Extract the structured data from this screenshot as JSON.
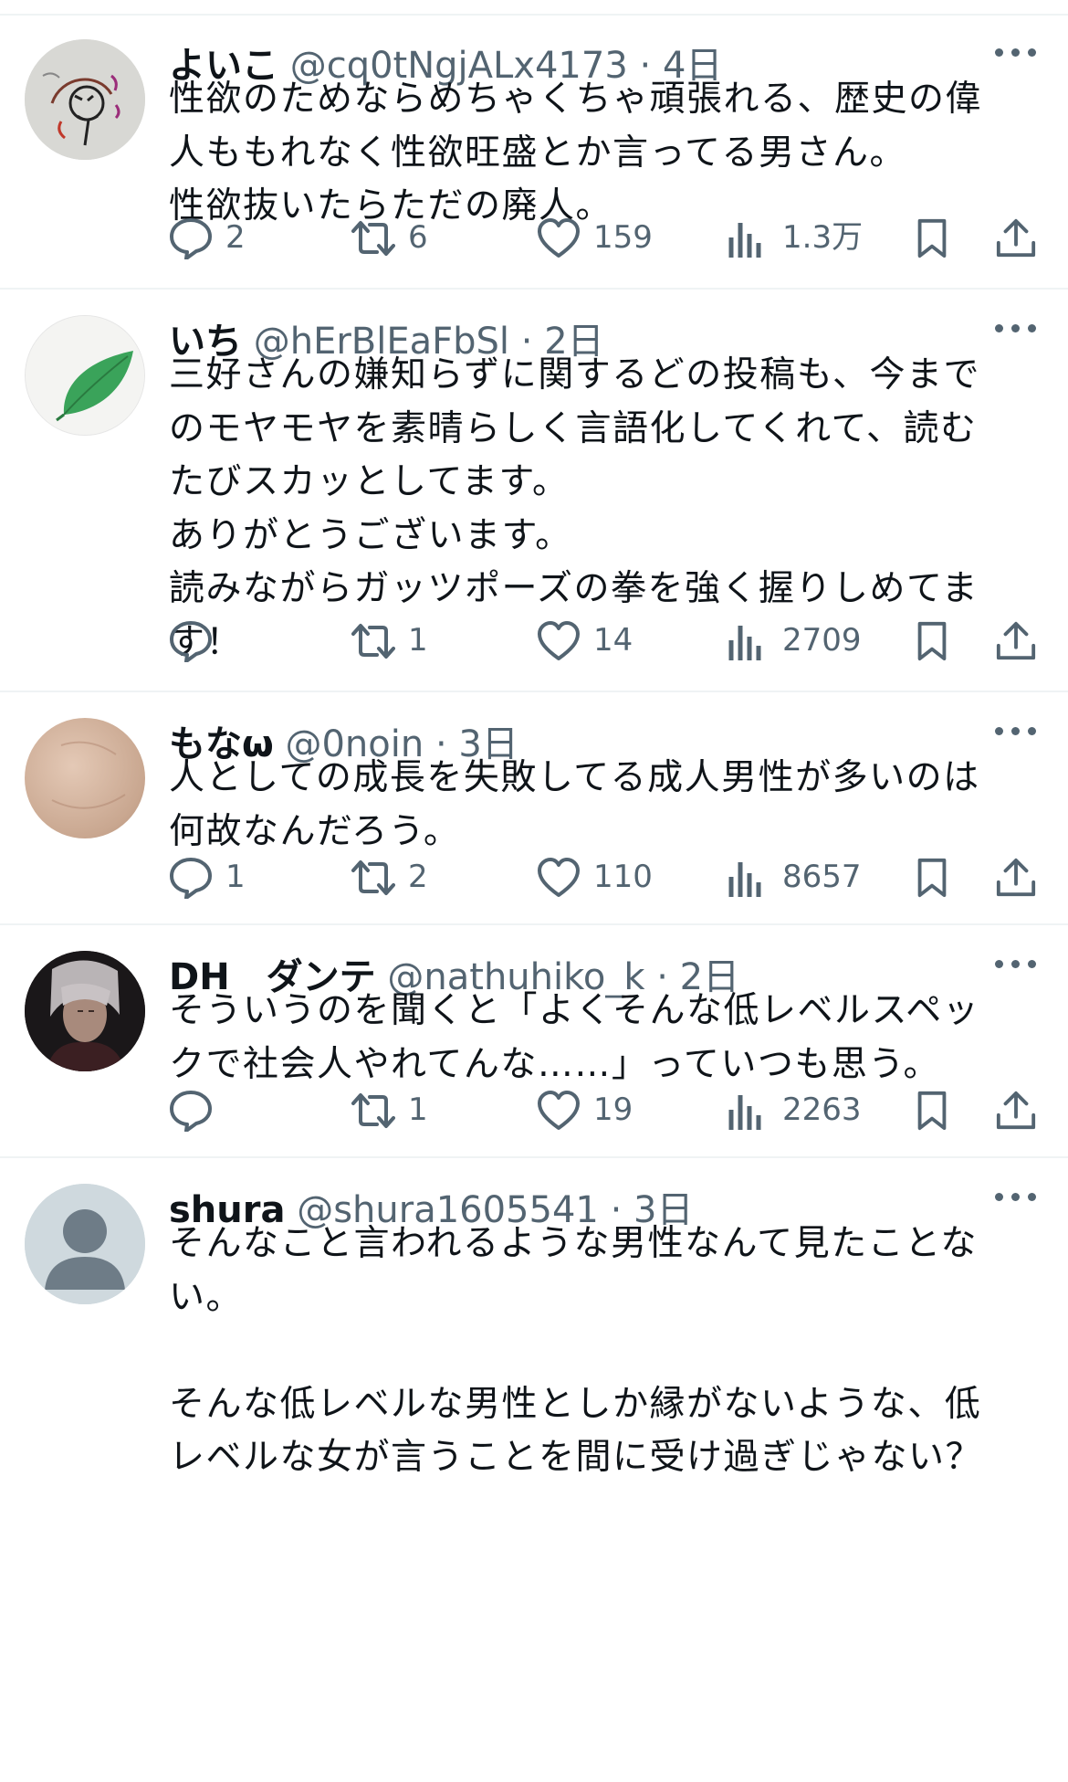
{
  "posts": [
    {
      "name": "よいこ",
      "handle": "@cq0tNgjALx4173",
      "sep": "·",
      "time": "4日",
      "text": "性欲のためならめちゃくちゃ頑張れる、歴史の偉\n人ももれなく性欲旺盛とか言ってる男さん。\n性欲抜いたらただの廃人。",
      "replies": "2",
      "reposts": "6",
      "likes": "159",
      "views": "1.3万",
      "avatar_icon": "sketch-avatar"
    },
    {
      "name": "いち",
      "handle": "@hErBlEaFbSl",
      "sep": "·",
      "time": "2日",
      "text": "三好さんの嫌知らずに関するどの投稿も、今まで\nのモヤモヤを素晴らしく言語化してくれて、読む\nたびスカッとしてます。\nありがとうございます。\n読みながらガッツポーズの拳を強く握りしめてま\nす！",
      "replies": "",
      "reposts": "1",
      "likes": "14",
      "views": "2709",
      "avatar_icon": "leaf-avatar"
    },
    {
      "name": "もなω",
      "handle": "@0noin",
      "sep": "·",
      "time": "3日",
      "text": "人としての成長を失敗してる成人男性が多いのは\n何故なんだろう。",
      "replies": "1",
      "reposts": "2",
      "likes": "110",
      "views": "8657",
      "avatar_icon": "skin-photo-avatar"
    },
    {
      "name": "DH　ダンテ",
      "handle": "@nathuhiko_k",
      "sep": "·",
      "time": "2日",
      "text": "そういうのを聞くと「よくそんな低レベルスペッ\nクで社会人やれてんな……」っていつも思う。",
      "replies": "",
      "reposts": "1",
      "likes": "19",
      "views": "2263",
      "avatar_icon": "character-avatar"
    },
    {
      "name": "shura",
      "handle": "@shura1605541",
      "sep": "·",
      "time": "3日",
      "text": "そんなこと言われるような男性なんて見たことな\nい。\n\nそんな低レベルな男性としか縁がないような、低\nレベルな女が言うことを間に受け過ぎじゃない？",
      "avatar_icon": "default-person-avatar"
    }
  ],
  "colors": {
    "text": "#0f1419",
    "secondary": "#536471",
    "divider": "#eff3f4",
    "default_avatar_bg": "#cfd9de"
  },
  "icons": [
    "reply-icon",
    "repost-icon",
    "like-icon",
    "views-icon",
    "bookmark-icon",
    "share-icon",
    "more-icon"
  ]
}
